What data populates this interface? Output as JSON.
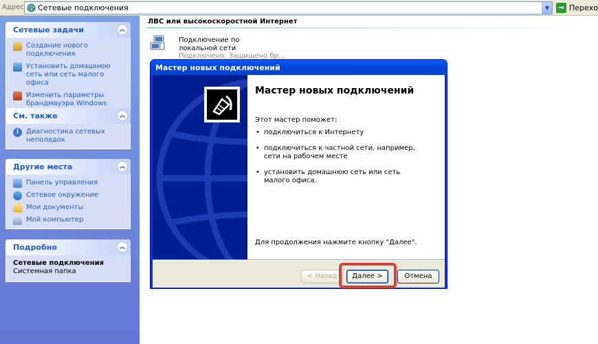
{
  "address_bar": {
    "label": "Адрес:",
    "value": "Сетевые подключения",
    "go_label": "Переход"
  },
  "taskpane": {
    "network_tasks": {
      "title": "Сетевые задачи",
      "items": [
        {
          "label": "Создание нового подключения",
          "icon": "new-connection-icon"
        },
        {
          "label": "Установить домашнюю сеть или сеть малого офиса",
          "icon": "home-network-icon"
        },
        {
          "label": "Изменить параметры брандмауэра Windows",
          "icon": "firewall-icon"
        }
      ]
    },
    "see_also": {
      "title": "См. также",
      "items": [
        {
          "label": "Диагностика сетевых неполадок",
          "icon": "info-icon"
        }
      ]
    },
    "other_places": {
      "title": "Другие места",
      "items": [
        {
          "label": "Панель управления",
          "icon": "control-panel-icon"
        },
        {
          "label": "Сетевое окружение",
          "icon": "network-places-icon"
        },
        {
          "label": "Мои документы",
          "icon": "my-documents-icon"
        },
        {
          "label": "Мой компьютер",
          "icon": "my-computer-icon"
        }
      ]
    },
    "details": {
      "title": "Подробно",
      "name": "Сетевые подключения",
      "type": "Системная папка"
    }
  },
  "main": {
    "group_header": "ЛВС или высокоскоростной Интернет",
    "connection": {
      "name": "Подключение по локальной сети",
      "status": "Подключено, Защищено бр..."
    }
  },
  "wizard": {
    "window_title": "Мастер новых подключений",
    "heading": "Мастер новых подключений",
    "intro": "Этот мастер поможет:",
    "bullets": [
      "подключиться к Интернету",
      "подключиться к частной сети, например, сети на рабочем месте",
      "установить домашнюю сеть или сеть малого офиса."
    ],
    "footer": "Для продолжения нажмите кнопку \"Далее\".",
    "buttons": {
      "back": "< Назад",
      "next": "Далее >",
      "cancel": "Отмена"
    }
  },
  "colors": {
    "highlight": "#d0433d",
    "titlebar": "#0a5bf0",
    "link": "#215dc6"
  }
}
